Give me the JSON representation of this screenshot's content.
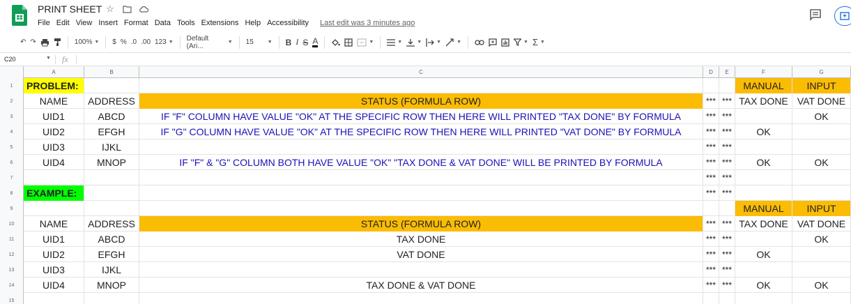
{
  "app": {
    "title": "PRINT SHEET",
    "last_edit": "Last edit was 3 minutes ago",
    "menu": [
      "File",
      "Edit",
      "View",
      "Insert",
      "Format",
      "Data",
      "Tools",
      "Extensions",
      "Help",
      "Accessibility"
    ]
  },
  "toolbar": {
    "zoom": "100%",
    "currency": "$",
    "percent": "%",
    "dec_decrease": ".0",
    "dec_increase": ".00",
    "more_formats": "123",
    "font": "Default (Ari...",
    "font_size": "15",
    "bold": "B",
    "italic": "I",
    "strike": "S",
    "text_color": "A",
    "sigma": "Σ"
  },
  "formula_bar": {
    "cell_ref": "C20",
    "fx": "fx",
    "value": ""
  },
  "columns": [
    "A",
    "B",
    "C",
    "D",
    "E",
    "F",
    "G"
  ],
  "rows": [
    {
      "num": "1",
      "A": "PROBLEM:",
      "B": "",
      "C": "",
      "D": "",
      "E": "",
      "F": "MANUAL",
      "G": "INPUT"
    },
    {
      "num": "2",
      "A": "NAME",
      "B": "ADDRESS",
      "C": "STATUS (FORMULA ROW)",
      "D": "***",
      "E": "***",
      "F": "TAX DONE",
      "G": "VAT DONE"
    },
    {
      "num": "3",
      "A": "UID1",
      "B": "ABCD",
      "C": "IF \"F\" COLUMN HAVE VALUE \"OK\" AT THE SPECIFIC ROW THEN HERE WILL PRINTED \"TAX DONE\" BY FORMULA",
      "D": "***",
      "E": "***",
      "F": "",
      "G": "OK"
    },
    {
      "num": "4",
      "A": "UID2",
      "B": "EFGH",
      "C": "IF \"G\" COLUMN HAVE VALUE \"OK\" AT THE SPECIFIC ROW THEN HERE WILL PRINTED \"VAT DONE\" BY FORMULA",
      "D": "***",
      "E": "***",
      "F": "OK",
      "G": ""
    },
    {
      "num": "5",
      "A": "UID3",
      "B": "IJKL",
      "C": "",
      "D": "***",
      "E": "***",
      "F": "",
      "G": ""
    },
    {
      "num": "6",
      "A": "UID4",
      "B": "MNOP",
      "C": "IF \"F\" & \"G\" COLUMN BOTH HAVE VALUE \"OK\" \"TAX DONE & VAT DONE\" WILL BE PRINTED BY FORMULA",
      "D": "***",
      "E": "***",
      "F": "OK",
      "G": "OK"
    },
    {
      "num": "7",
      "A": "",
      "B": "",
      "C": "",
      "D": "***",
      "E": "***",
      "F": "",
      "G": ""
    },
    {
      "num": "8",
      "A": "EXAMPLE:",
      "B": "",
      "C": "",
      "D": "***",
      "E": "***",
      "F": "",
      "G": ""
    },
    {
      "num": "9",
      "A": "",
      "B": "",
      "C": "",
      "D": "",
      "E": "",
      "F": "MANUAL",
      "G": "INPUT"
    },
    {
      "num": "10",
      "A": "NAME",
      "B": "ADDRESS",
      "C": "STATUS (FORMULA ROW)",
      "D": "***",
      "E": "***",
      "F": "TAX DONE",
      "G": "VAT DONE"
    },
    {
      "num": "11",
      "A": "UID1",
      "B": "ABCD",
      "C": "TAX DONE",
      "D": "***",
      "E": "***",
      "F": "",
      "G": "OK"
    },
    {
      "num": "12",
      "A": "UID2",
      "B": "EFGH",
      "C": "VAT DONE",
      "D": "***",
      "E": "***",
      "F": "OK",
      "G": ""
    },
    {
      "num": "13",
      "A": "UID3",
      "B": "IJKL",
      "C": "",
      "D": "***",
      "E": "***",
      "F": "",
      "G": ""
    },
    {
      "num": "14",
      "A": "UID4",
      "B": "MNOP",
      "C": "TAX DONE & VAT DONE",
      "D": "***",
      "E": "***",
      "F": "OK",
      "G": "OK"
    },
    {
      "num": "15",
      "A": "",
      "B": "",
      "C": "",
      "D": "",
      "E": "",
      "F": "",
      "G": ""
    }
  ],
  "colors": {
    "yellow": "#ffff00",
    "green": "#00ff00",
    "orange": "#fbbc04",
    "formula_text": "#1d10b8",
    "sheets_green": "#0f9d58"
  }
}
